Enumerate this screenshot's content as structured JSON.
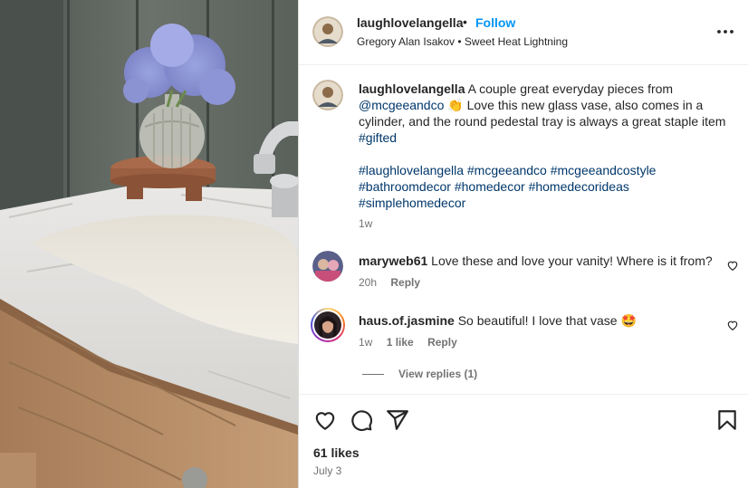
{
  "post": {
    "username": "laughlovelangella",
    "dot": "•",
    "follow_label": "Follow",
    "audio": "Gregory Alan Isakov • Sweet Heat Lightning"
  },
  "caption": {
    "username": "laughlovelangella",
    "text_pre": "A couple great everyday pieces from",
    "mention": "@mcgeeandco",
    "emoji": "👏",
    "text_post": "Love this new glass vase, also comes in a cylinder, and the round pedestal tray is always a great staple item",
    "tag_gifted": "#gifted",
    "hashtags": [
      "#laughlovelangella",
      "#mcgeeandco",
      "#mcgeeandcostyle",
      "#bathroomdecor",
      "#homedecor",
      "#homedecorideas",
      "#simplehomedecor"
    ],
    "time": "1w"
  },
  "comments": [
    {
      "username": "maryweb61",
      "text": "Love these and love your vanity! Where is it from?",
      "time": "20h",
      "reply_label": "Reply"
    },
    {
      "username": "haus.of.jasmine",
      "text": "So beautiful! I love that vase",
      "emoji": "🤩",
      "time": "1w",
      "likes": "1 like",
      "reply_label": "Reply"
    }
  ],
  "view_replies_label": "View replies (1)",
  "footer": {
    "likes": "61 likes",
    "date": "July 3"
  },
  "icons": {
    "more": "more-options-icon",
    "like": "heart-icon",
    "comment": "comment-icon",
    "share": "share-icon",
    "save": "bookmark-icon"
  },
  "colors": {
    "follow": "#0095f6",
    "link": "#00376b",
    "secondary_text": "#737373"
  }
}
